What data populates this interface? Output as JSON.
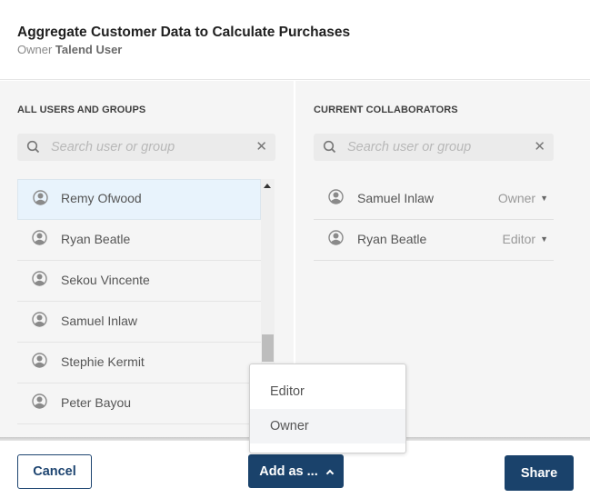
{
  "dialog": {
    "title": "Aggregate Customer Data to Calculate Purchases",
    "owner_label": "Owner",
    "owner_name": "Talend User"
  },
  "all_users": {
    "section_label": "ALL USERS AND GROUPS",
    "search": {
      "placeholder": "Search user or group",
      "value": "",
      "icon": "search-icon",
      "clear_icon": "close-icon",
      "clear_glyph": "✕"
    },
    "items": [
      {
        "name": "Remy Ofwood",
        "selected": true,
        "icon": "user-avatar-icon"
      },
      {
        "name": "Ryan Beatle",
        "selected": false,
        "icon": "user-avatar-icon"
      },
      {
        "name": "Sekou Vincente",
        "selected": false,
        "icon": "user-avatar-icon"
      },
      {
        "name": "Samuel Inlaw",
        "selected": false,
        "icon": "user-avatar-icon"
      },
      {
        "name": "Stephie Kermit",
        "selected": false,
        "icon": "user-avatar-icon"
      },
      {
        "name": "Peter Bayou",
        "selected": false,
        "icon": "user-avatar-icon"
      }
    ]
  },
  "collaborators": {
    "section_label": "CURRENT COLLABORATORS",
    "search": {
      "placeholder": "Search user or group",
      "value": "",
      "icon": "search-icon",
      "clear_icon": "close-icon",
      "clear_glyph": "✕"
    },
    "items": [
      {
        "name": "Samuel Inlaw",
        "role": "Owner",
        "icon": "user-avatar-icon"
      },
      {
        "name": "Ryan Beatle",
        "role": "Editor",
        "icon": "user-avatar-icon"
      }
    ],
    "caret_glyph": "▼"
  },
  "add_as_menu": {
    "items": [
      {
        "label": "Editor",
        "hovered": false
      },
      {
        "label": "Owner",
        "hovered": true
      }
    ]
  },
  "footer": {
    "cancel_label": "Cancel",
    "add_as_label": "Add as ...",
    "share_label": "Share"
  },
  "colors": {
    "primary": "#1a426b",
    "selected_row": "#e8f3fc",
    "panel_bg": "#f5f5f5"
  }
}
